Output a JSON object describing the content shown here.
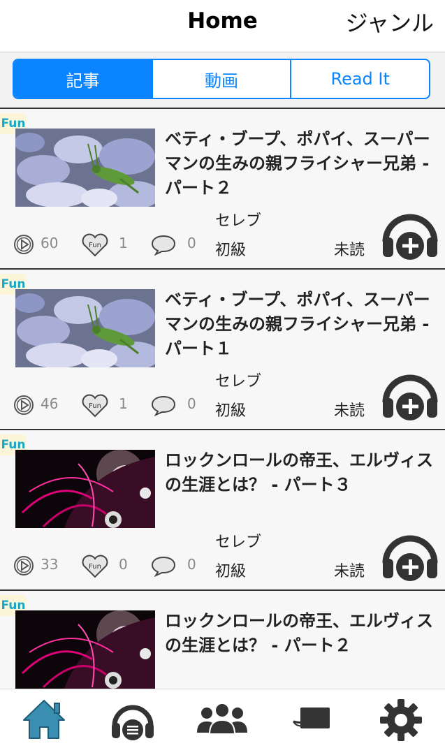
{
  "nav": {
    "title": "Home",
    "genre_link": "ジャンル"
  },
  "segments": [
    {
      "label": "記事",
      "active": true
    },
    {
      "label": "動画",
      "active": false
    },
    {
      "label": "Read It",
      "active": false
    }
  ],
  "articles": [
    {
      "badge": "Fun",
      "title": "ベティ・ブープ、ポパイ、スーパーマンの生みの親フライシャー兄弟 - パート２",
      "plays": "60",
      "likes": "1",
      "comments": "0",
      "genre": "セレブ",
      "level": "初級",
      "read_status": "未読",
      "image": "grasshopper-on-hydrangea"
    },
    {
      "badge": "Fun",
      "title": "ベティ・ブープ、ポパイ、スーパーマンの生みの親フライシャー兄弟 - パート１",
      "plays": "46",
      "likes": "1",
      "comments": "0",
      "genre": "セレブ",
      "level": "初級",
      "read_status": "未読",
      "image": "grasshopper-on-hydrangea"
    },
    {
      "badge": "Fun",
      "title": "ロックンロールの帝王、エルヴィスの生涯とは？ - パート３",
      "plays": "33",
      "likes": "0",
      "comments": "0",
      "genre": "セレブ",
      "level": "初級",
      "read_status": "未読",
      "image": "magenta-portrait"
    },
    {
      "badge": "Fun",
      "title": "ロックンロールの帝王、エルヴィスの生涯とは？ - パート２",
      "plays": "",
      "likes": "",
      "comments": "",
      "genre": "",
      "level": "",
      "read_status": "",
      "image": "magenta-portrait"
    }
  ],
  "tabbar": [
    {
      "icon": "home-icon",
      "active": true
    },
    {
      "icon": "headphones-list-icon",
      "active": false
    },
    {
      "icon": "people-icon",
      "active": false
    },
    {
      "icon": "card-icon",
      "active": false
    },
    {
      "icon": "gear-icon",
      "active": false
    }
  ],
  "colors": {
    "accent": "#0a84ff",
    "badge_text": "#19a7c7",
    "badge_bg": "#fdf5d8",
    "icon_dark": "#333333",
    "home_active": "#3a8fb0"
  }
}
